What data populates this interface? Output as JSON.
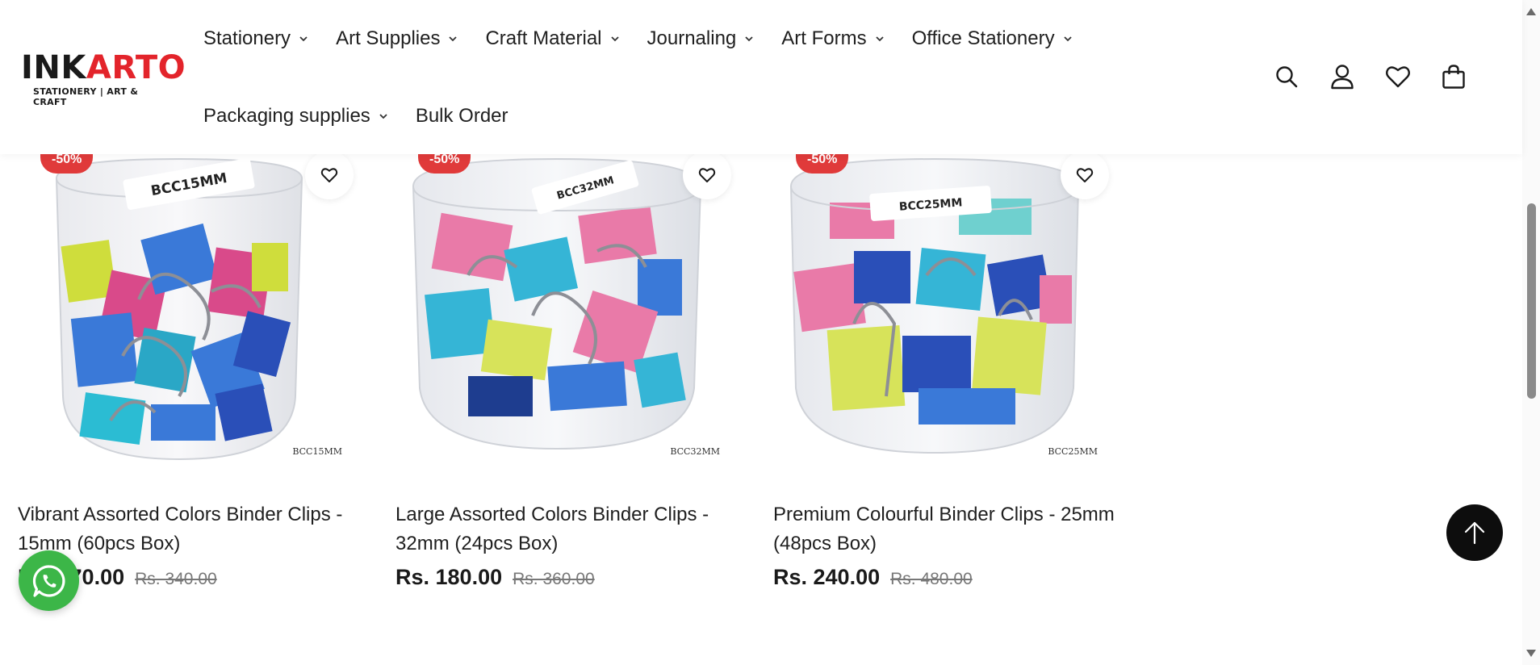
{
  "brand": {
    "logo_part1": "INK",
    "logo_part2": "ARTO",
    "tagline": "STATIONERY | ART & CRAFT",
    "accent_color": "#e3242b"
  },
  "nav": {
    "row1": [
      {
        "label": "Stationery",
        "has_dropdown": true
      },
      {
        "label": "Art Supplies",
        "has_dropdown": true
      },
      {
        "label": "Craft Material",
        "has_dropdown": true
      },
      {
        "label": "Journaling",
        "has_dropdown": true
      },
      {
        "label": "Art Forms",
        "has_dropdown": true
      },
      {
        "label": "Office Stationery",
        "has_dropdown": true
      }
    ],
    "row2": [
      {
        "label": "Packaging supplies",
        "has_dropdown": true
      },
      {
        "label": "Bulk Order",
        "has_dropdown": false
      }
    ]
  },
  "header_icons": [
    "search-icon",
    "account-icon",
    "wishlist-icon",
    "cart-icon"
  ],
  "products": [
    {
      "discount": "-50%",
      "image_code": "BCC15MM",
      "lid_label": "BCC15MM",
      "title": "Vibrant Assorted Colors Binder Clips - 15mm (60pcs Box)",
      "price": "Rs. 170.00",
      "old_price": "Rs. 340.00"
    },
    {
      "discount": "-50%",
      "image_code": "BCC32MM",
      "lid_label": "BCC32MM",
      "title": "Large Assorted Colors Binder Clips - 32mm (24pcs Box)",
      "price": "Rs. 180.00",
      "old_price": "Rs. 360.00"
    },
    {
      "discount": "-50%",
      "image_code": "BCC25MM",
      "lid_label": "BCC25MM",
      "title": "Premium Colourful Binder Clips - 25mm (48pcs Box)",
      "price": "Rs. 240.00",
      "old_price": "Rs. 480.00"
    }
  ],
  "floating": {
    "whatsapp_icon": "whatsapp-icon",
    "whatsapp_color": "#3cb648",
    "back_to_top_icon": "arrow-up-icon"
  }
}
